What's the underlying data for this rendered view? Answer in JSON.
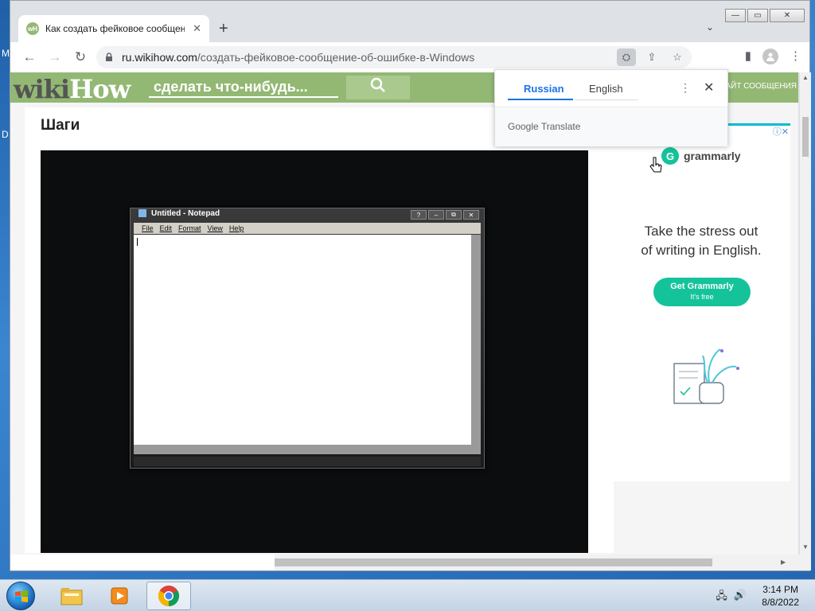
{
  "desktop": {
    "frag_top": "M",
    "frag_mid": "D"
  },
  "browser": {
    "tab": {
      "favicon_text": "wH",
      "title": "Как создать фейковое сообщен",
      "close": "✕"
    },
    "new_tab": "+",
    "tab_search": "⌄",
    "window": {
      "minimize": "—",
      "maximize": "▭",
      "close": "✕"
    },
    "nav": {
      "back": "←",
      "forward": "→",
      "reload": "↻"
    },
    "url": {
      "host": "ru.wikihow.com",
      "path": "/создать-фейковое-сообщение-об-ошибке-в-Windows"
    },
    "omni": {
      "translate": "⛭",
      "share": "⇪",
      "bookmark": "☆"
    },
    "toolbar": {
      "sidepanel": "▮",
      "menu": "⋮"
    }
  },
  "wikihow": {
    "logo_wiki": "wiki",
    "logo_how": "How",
    "search_placeholder": "сделать что-нибудь...",
    "search_icon": "⚲",
    "right_text": "САЙТ СООБЩЕНИЯ"
  },
  "steps": {
    "title": "Шаги"
  },
  "notepad": {
    "title": "Untitled - Notepad",
    "controls": [
      "?",
      "–",
      "⧉",
      "✕"
    ],
    "menu": [
      "File",
      "Edit",
      "Format",
      "View",
      "Help"
    ]
  },
  "ad": {
    "choices": "ⓘ✕",
    "brand_letter": "G",
    "brand": "grammarly",
    "headline_1": "Take the stress out",
    "headline_2": "of writing in English.",
    "cta_1": "Get Grammarly",
    "cta_2": "It's free"
  },
  "translate": {
    "source": "Russian",
    "target": "English",
    "more": "⋮",
    "close": "✕",
    "brand": "Google Translate"
  },
  "scroll": {
    "up": "▲",
    "down": "▼",
    "right": "▶"
  },
  "taskbar": {
    "time": "3:14 PM",
    "date": "8/8/2022",
    "tray_network": "🖧",
    "tray_volume": "🔊"
  }
}
